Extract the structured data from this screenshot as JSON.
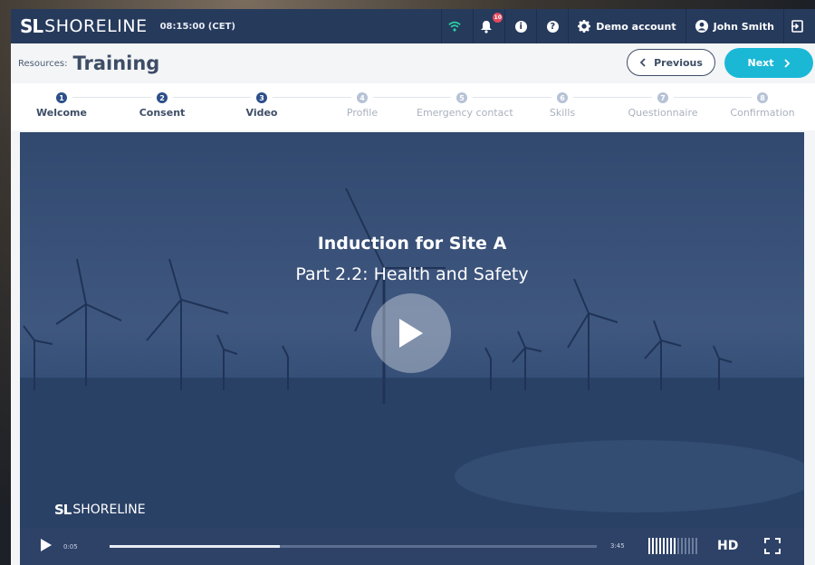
{
  "app": {
    "logo_mark": "SL",
    "logo_text": "SHORELINE",
    "clock": "08:15:00 (CET)"
  },
  "topbar": {
    "notification_count": "10",
    "info_icon": "i",
    "help_icon": "?",
    "demo_label": "Demo account",
    "user_name": "John Smith"
  },
  "breadcrumb": {
    "label": "Resources:",
    "title": "Training",
    "prev_label": "Previous",
    "next_label": "Next"
  },
  "steps": [
    {
      "num": "1",
      "label": "Welcome",
      "state": "active"
    },
    {
      "num": "2",
      "label": "Consent",
      "state": "active"
    },
    {
      "num": "3",
      "label": "Video",
      "state": "active"
    },
    {
      "num": "4",
      "label": "Profile",
      "state": "inactive"
    },
    {
      "num": "5",
      "label": "Emergency contact",
      "state": "inactive"
    },
    {
      "num": "6",
      "label": "Skills",
      "state": "inactive"
    },
    {
      "num": "7",
      "label": "Questionnaire",
      "state": "inactive"
    },
    {
      "num": "8",
      "label": "Confirmation",
      "state": "inactive"
    }
  ],
  "video": {
    "title": "Induction for Site A",
    "subtitle": "Part 2.2: Health and Safety",
    "watermark_mark": "SL",
    "watermark_text": "SHORELINE",
    "time_current": "0:05",
    "time_total": "3:45",
    "progress": 0.35,
    "quality": "HD"
  },
  "colors": {
    "primary": "#263a5c",
    "accent": "#1bb8d6",
    "step_active": "#2d4f8a"
  }
}
